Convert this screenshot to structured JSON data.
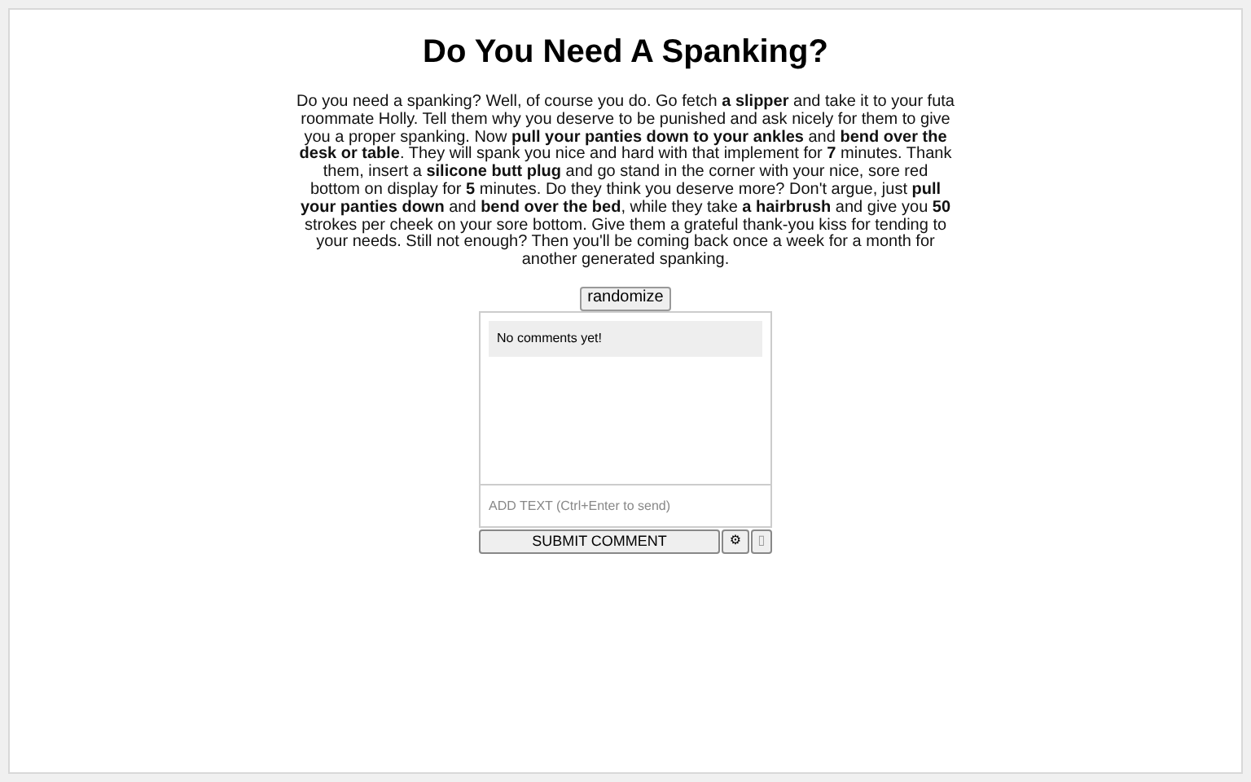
{
  "title": "Do You Need A Spanking?",
  "paragraph": "Do you need a spanking? Well, of course you do. Go fetch **a slipper** and take it to your futa roommate Holly. Tell them why you deserve to be punished and ask nicely for them to give you a proper spanking. Now **pull your panties down to your ankles** and **bend over the desk or table**. They will spank you nice and hard with that implement for **7** minutes. Thank them, insert a **silicone butt plug** and go stand in the corner with your nice, sore red bottom on display for **5** minutes. Do they think you deserve more? Don't argue, just **pull your panties down** and **bend over the bed**, while they take **a hairbrush** and give you **50** strokes per cheek on your sore bottom. Give them a grateful thank-you kiss for tending to your needs. Still not enough? Then you'll be coming back once a week for a month for another generated spanking.",
  "randomize_button": "randomize",
  "comments": {
    "empty_message": "No comments yet!",
    "input": {
      "placeholder": "ADD TEXT (Ctrl+Enter to send)"
    },
    "submit_button": "SUBMIT COMMENT",
    "settings_button": "⚙",
    "extra_button": "▯"
  }
}
